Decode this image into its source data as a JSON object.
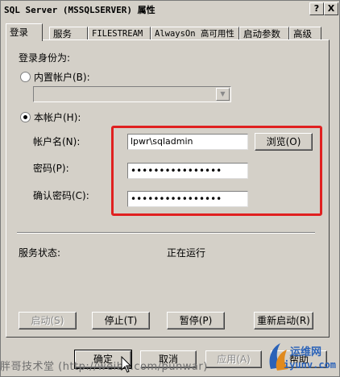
{
  "window": {
    "title": "SQL Server (MSSQLSERVER) 属性",
    "help_label": "?",
    "close_label": "X"
  },
  "tabs": [
    {
      "label": "登录",
      "active": true
    },
    {
      "label": "服务"
    },
    {
      "label": "FILESTREAM"
    },
    {
      "label": "AlwaysOn 高可用性"
    },
    {
      "label": "启动参数"
    },
    {
      "label": "高级"
    }
  ],
  "login": {
    "section_label": "登录身份为:",
    "builtin_account_label": "内置帐户(B):",
    "builtin_account_value": "",
    "this_account_label": "本帐户(H):",
    "this_account_selected": true,
    "account_name_label": "帐户名(N):",
    "account_name_value": "lpwr\\sqladmin",
    "browse_label": "浏览(O)",
    "password_label": "密码(P):",
    "password_value": "••••••••••••••••",
    "confirm_password_label": "确认密码(C):",
    "confirm_password_value": "••••••••••••••••"
  },
  "service": {
    "status_label": "服务状态:",
    "status_value": "正在运行",
    "start_label": "启动(S)",
    "stop_label": "停止(T)",
    "pause_label": "暂停(P)",
    "restart_label": "重新启动(R)"
  },
  "footer": {
    "ok_label": "确定",
    "cancel_label": "取消",
    "apply_label": "应用(A)",
    "help_label": "帮助"
  },
  "watermark": {
    "text": "胖哥技术堂 (http://weibo.com/punwar)",
    "logo_text": "运维网",
    "logo_url": "iyunv.com"
  },
  "colors": {
    "highlight_box": "#e02020",
    "dialog_bg": "#d4d0c8"
  }
}
